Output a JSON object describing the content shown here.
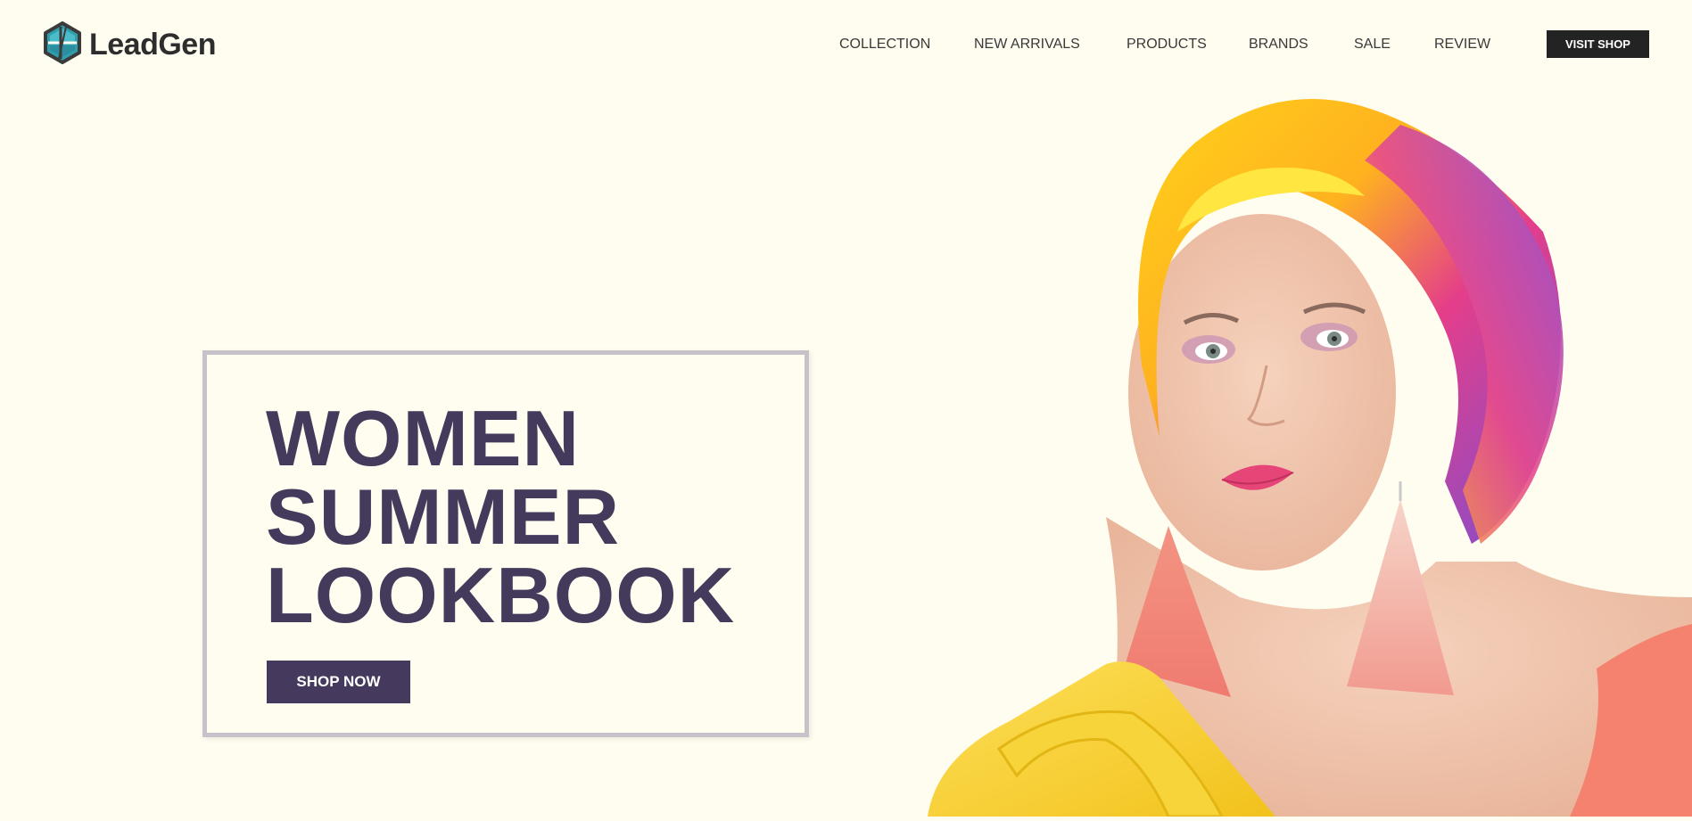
{
  "brand": {
    "name": "LeadGen",
    "logo_icon": "hexagon-logo-icon"
  },
  "nav": {
    "items": [
      "COLLECTION",
      "NEW ARRIVALS",
      "PRODUCTS",
      "BRANDS",
      "SALE",
      "REVIEW"
    ],
    "cta_label": "VISIT SHOP"
  },
  "hero": {
    "title_lines": [
      "WOMEN",
      "SUMMER",
      "LOOKBOOK"
    ],
    "button_label": "SHOP NOW",
    "image": "woman-with-colorful-headscarf-photo"
  },
  "colors": {
    "background": "#fffdf0",
    "accent": "#453a5e",
    "dark": "#232323",
    "box_border": "#c7c2ca"
  }
}
